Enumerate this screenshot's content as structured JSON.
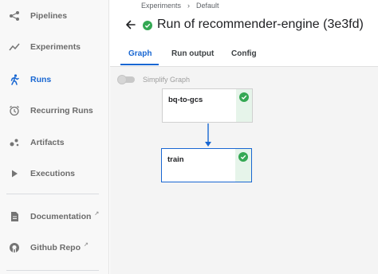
{
  "sidebar": {
    "items": [
      {
        "label": "Pipelines",
        "icon": "pipelines-icon",
        "active": false
      },
      {
        "label": "Experiments",
        "icon": "experiments-icon",
        "active": false
      },
      {
        "label": "Runs",
        "icon": "runs-icon",
        "active": true
      },
      {
        "label": "Recurring Runs",
        "icon": "recurring-runs-icon",
        "active": false
      },
      {
        "label": "Artifacts",
        "icon": "artifacts-icon",
        "active": false
      },
      {
        "label": "Executions",
        "icon": "executions-icon",
        "active": false
      },
      {
        "label": "Documentation",
        "icon": "documentation-icon",
        "external": true
      },
      {
        "label": "Github Repo",
        "icon": "github-icon",
        "external": true
      }
    ]
  },
  "header": {
    "breadcrumbs": [
      "Experiments",
      "Default"
    ],
    "breadcrumb_separator": "›",
    "title": "Run of recommender-engine (3e3fd)",
    "status": "succeeded"
  },
  "tabs": [
    {
      "label": "Graph",
      "active": true
    },
    {
      "label": "Run output",
      "active": false
    },
    {
      "label": "Config",
      "active": false
    }
  ],
  "graph": {
    "simplify_label": "Simplify Graph",
    "simplify_enabled": false,
    "nodes": [
      {
        "label": "bq-to-gcs",
        "status": "succeeded",
        "selected": false
      },
      {
        "label": "train",
        "status": "succeeded",
        "selected": true
      }
    ]
  },
  "colors": {
    "accent": "#1967d2",
    "success": "#34a853",
    "success_bg": "#e6f4ea",
    "canvas_bg": "#f4f4f4",
    "sidebar_bg": "#f8f8f8"
  }
}
